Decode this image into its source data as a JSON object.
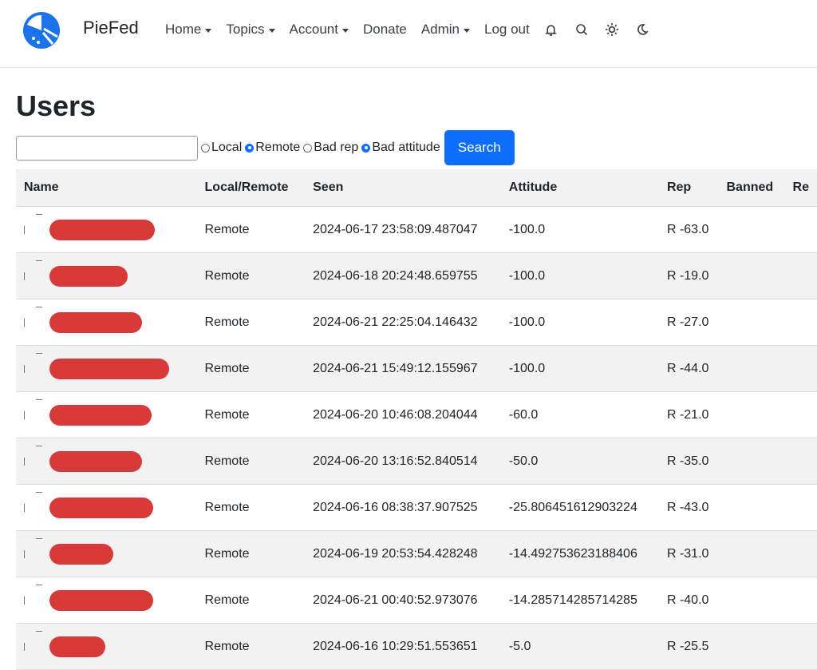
{
  "navbar": {
    "brand": "PieFed",
    "items": [
      {
        "label": "Home",
        "dropdown": true
      },
      {
        "label": "Topics",
        "dropdown": true
      },
      {
        "label": "Account",
        "dropdown": true
      },
      {
        "label": "Donate",
        "dropdown": false
      },
      {
        "label": "Admin",
        "dropdown": true
      },
      {
        "label": "Log out",
        "dropdown": false
      }
    ],
    "icons": [
      "bell-icon",
      "search-icon",
      "sun-icon",
      "moon-icon"
    ]
  },
  "page": {
    "title": "Users"
  },
  "search": {
    "input_value": "",
    "radios": [
      {
        "label": "Local",
        "checked": false
      },
      {
        "label": "Remote",
        "checked": true
      },
      {
        "label": "Bad rep",
        "checked": false
      },
      {
        "label": "Bad attitude",
        "checked": true
      }
    ],
    "button_label": "Search"
  },
  "table": {
    "headers": [
      "Name",
      "Local/Remote",
      "Seen",
      "Attitude",
      "Rep",
      "Banned",
      "Re"
    ],
    "rows": [
      {
        "type": "Remote",
        "seen": "2024-06-17 23:58:09.487047",
        "attitude": "-100.0",
        "rep": "R -63.0",
        "banned": ""
      },
      {
        "type": "Remote",
        "seen": "2024-06-18 20:24:48.659755",
        "attitude": "-100.0",
        "rep": "R -19.0",
        "banned": ""
      },
      {
        "type": "Remote",
        "seen": "2024-06-21 22:25:04.146432",
        "attitude": "-100.0",
        "rep": "R -27.0",
        "banned": ""
      },
      {
        "type": "Remote",
        "seen": "2024-06-21 15:49:12.155967",
        "attitude": "-100.0",
        "rep": "R -44.0",
        "banned": ""
      },
      {
        "type": "Remote",
        "seen": "2024-06-20 10:46:08.204044",
        "attitude": "-60.0",
        "rep": "R -21.0",
        "banned": ""
      },
      {
        "type": "Remote",
        "seen": "2024-06-20 13:16:52.840514",
        "attitude": "-50.0",
        "rep": "R -35.0",
        "banned": ""
      },
      {
        "type": "Remote",
        "seen": "2024-06-16 08:38:37.907525",
        "attitude": "-25.806451612903224",
        "rep": "R -43.0",
        "banned": ""
      },
      {
        "type": "Remote",
        "seen": "2024-06-19 20:53:54.428248",
        "attitude": "-14.492753623188406",
        "rep": "R -31.0",
        "banned": ""
      },
      {
        "type": "Remote",
        "seen": "2024-06-21 00:40:52.973076",
        "attitude": "-14.285714285714285",
        "rep": "R -40.0",
        "banned": ""
      },
      {
        "type": "Remote",
        "seen": "2024-06-16 10:29:51.553651",
        "attitude": "-5.0",
        "rep": "R -25.5",
        "banned": ""
      }
    ]
  },
  "colors": {
    "primary": "#0d6efd",
    "redaction": "#d83a3a",
    "header_bg": "#f2f2f2"
  }
}
